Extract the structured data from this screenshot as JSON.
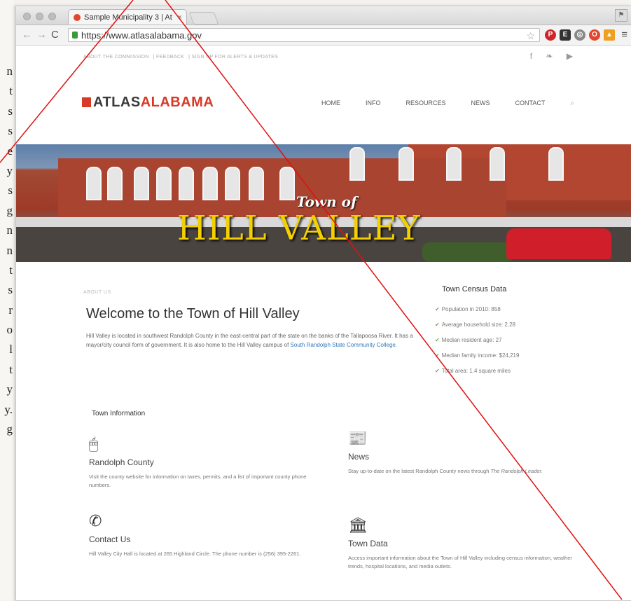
{
  "margin_text": [
    "n",
    "t",
    "s",
    "s",
    "e",
    "y",
    "s",
    "g",
    "n",
    "n",
    "t",
    "s",
    "r",
    "o",
    "l",
    "t",
    "y",
    "y.",
    "g"
  ],
  "browser": {
    "tab_title": "Sample Municipality 3 | At",
    "tab_close": "×",
    "url": "https://www.atlasalabama.gov",
    "star": "☆",
    "menu": "≡",
    "profile": "⚑"
  },
  "site": {
    "top_links": [
      "ABOUT THE COMMISSION",
      "FEEDBACK",
      "SIGN UP FOR ALERTS & UPDATES"
    ],
    "social": "f ❧ ▶",
    "logo_main": "ATLAS",
    "logo_accent": "ALABAMA",
    "nav": [
      "HOME",
      "INFO",
      "RESOURCES",
      "NEWS",
      "CONTACT"
    ],
    "hero_small": "Town of",
    "hero_big": "HILL VALLEY",
    "about_eyebrow": "ABOUT US",
    "welcome_title": "Welcome to the Town of Hill Valley",
    "intro_text": "Hill Valley is located in southwest Randolph County in the east-central part of the state on the banks of the Tallapoosa River. It has a mayor/city council form of government. It is also home to the Hill Valley campus of",
    "intro_link": "South Randolph State Community College.",
    "census_title": "Town Census Data",
    "census": [
      "Population in 2010: 858",
      "Average household size: 2.28",
      "Median resident age: 27",
      "Median family income: $24,219",
      "Total area: 1.4 square miles"
    ],
    "town_info_title": "Town Information",
    "cards": [
      {
        "title": "Randolph County",
        "text": "Visit the county website for information on taxes, permits, and a list of important county phone numbers."
      },
      {
        "title": "News",
        "text": "Stay up-to-date on the latest Randolph County news through",
        "text_em": "The Randolph Leader."
      },
      {
        "title": "Contact Us",
        "text": "Hill Valley City Hall is located at 265 Highland Circle. The phone number is (256) 395-2261."
      },
      {
        "title": "Town Data",
        "text": "Access important information about the Town of Hill Valley including census information, weather trends, hospital locations, and media outlets."
      }
    ]
  },
  "colors": {
    "accent_red": "#d93a27",
    "hero_yellow": "#f4d000",
    "link_blue": "#3178b8",
    "check_green": "#6aa84f"
  }
}
